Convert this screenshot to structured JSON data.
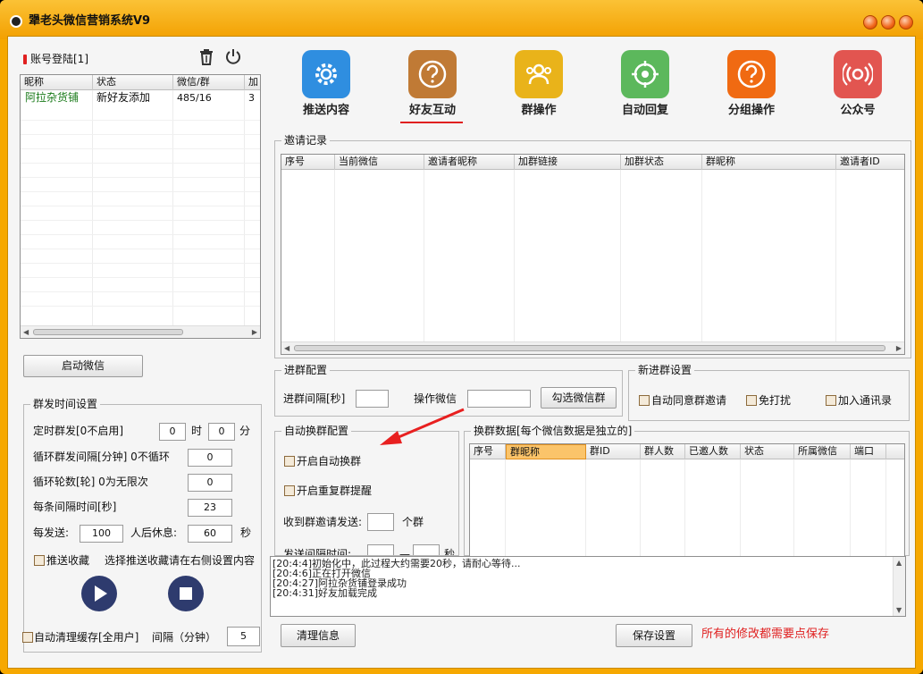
{
  "window": {
    "title": "犟老头微信营销系统V9"
  },
  "account": {
    "heading": "账号登陆[1]",
    "columns": [
      "昵称",
      "状态",
      "微信/群",
      "加"
    ],
    "rows": [
      {
        "nick": "阿拉杂货铺",
        "status": "新好友添加",
        "wx_group": "485/16",
        "add": "3"
      }
    ],
    "start_button": "启动微信"
  },
  "toolbar": [
    {
      "label": "推送内容",
      "icon": "gear-icon",
      "color": "#2f8ee0"
    },
    {
      "label": "好友互动",
      "icon": "question-icon",
      "color": "#c07a35"
    },
    {
      "label": "群操作",
      "icon": "group-icon",
      "color": "#e9b31a"
    },
    {
      "label": "自动回复",
      "icon": "target-icon",
      "color": "#5cb85c"
    },
    {
      "label": "分组操作",
      "icon": "question-icon",
      "color": "#f06a12"
    },
    {
      "label": "公众号",
      "icon": "broadcast-icon",
      "color": "#e25550"
    }
  ],
  "invite": {
    "title": "邀请记录",
    "columns": [
      "序号",
      "当前微信",
      "邀请者昵称",
      "加群链接",
      "加群状态",
      "群昵称",
      "邀请者ID"
    ]
  },
  "join_config": {
    "title": "进群配置",
    "interval_label": "进群间隔[秒]",
    "interval_value": "",
    "op_wechat_label": "操作微信",
    "op_wechat_value": "",
    "select_button": "勾选微信群"
  },
  "new_join": {
    "title": "新进群设置",
    "options": [
      "自动同意群邀请",
      "免打扰",
      "加入通讯录"
    ]
  },
  "auto_switch": {
    "title": "自动换群配置",
    "enable_label": "开启自动换群",
    "repeat_label": "开启重复群提醒",
    "received_label": "收到群邀请发送:",
    "received_value": "",
    "received_unit": "个群",
    "send_interval_label": "发送间隔时间:",
    "send_interval_unit": "秒"
  },
  "switch_data": {
    "title": "换群数据[每个微信数据是独立的]",
    "columns": [
      "序号",
      "群昵称",
      "群ID",
      "群人数",
      "已邀人数",
      "状态",
      "所属微信",
      "端口"
    ]
  },
  "schedule": {
    "title": "群发时间设置",
    "timed_label": "定时群发[0不启用]",
    "timed_hour": "0",
    "hour_unit": "时",
    "timed_min": "0",
    "min_unit": "分",
    "loop_interval_label": "循环群发间隔[分钟] 0不循环",
    "loop_interval_value": "0",
    "loop_rounds_label": "循环轮数[轮] 0为无限次",
    "loop_rounds_value": "0",
    "each_interval_label": "每条间隔时间[秒]",
    "each_interval_value": "23",
    "send_label": "每发送:",
    "send_value": "100",
    "rest_label": "人后休息:",
    "rest_value": "60",
    "rest_unit": "秒",
    "push_fav_label": "推送收藏",
    "push_fav_hint": "选择推送收藏请在右侧设置内容"
  },
  "log": {
    "lines": [
      "[20:4:4]初始化中，此过程大约需要20秒，请耐心等待...",
      "[20:4:6]正在打开微信",
      "[20:4:27]阿拉杂货铺登录成功",
      "[20:4:31]好友加载完成"
    ]
  },
  "bottom": {
    "auto_clear_label": "自动清理缓存[全用户]",
    "clear_interval_label": "间隔（分钟）",
    "clear_interval_value": "5",
    "clear_info_button": "清理信息",
    "save_button": "保存设置",
    "save_hint": "所有的修改都需要点保存"
  },
  "colors": {
    "accent": "#f6a800",
    "active_underline": "#e02020",
    "warn": "#e02020",
    "nick_green": "#1a7a1a"
  }
}
